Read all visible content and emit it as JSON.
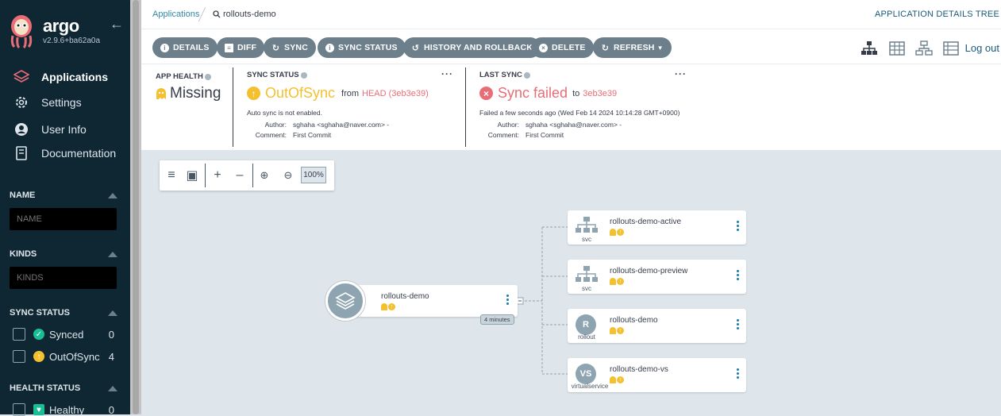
{
  "sidebar": {
    "brand": "argo",
    "version": "v2.9.6+ba62a0a",
    "nav": [
      {
        "label": "Applications",
        "icon": "layers-icon",
        "active": true
      },
      {
        "label": "Settings",
        "icon": "gear-icon",
        "active": false
      },
      {
        "label": "User Info",
        "icon": "user-icon",
        "active": false
      },
      {
        "label": "Documentation",
        "icon": "book-icon",
        "active": false
      }
    ],
    "filters": {
      "name": {
        "title": "NAME",
        "placeholder": "NAME"
      },
      "kinds": {
        "title": "KINDS",
        "placeholder": "KINDS"
      },
      "sync_status": {
        "title": "SYNC STATUS",
        "items": [
          {
            "label": "Synced",
            "count": "0",
            "color": "#18be94"
          },
          {
            "label": "OutOfSync",
            "count": "4",
            "color": "#f4c030"
          }
        ]
      },
      "health_status": {
        "title": "HEALTH STATUS",
        "items": [
          {
            "label": "Healthy",
            "count": "0",
            "color": "#18be94"
          }
        ]
      }
    }
  },
  "topbar": {
    "breadcrumb_root": "Applications",
    "breadcrumb_current": "rollouts-demo",
    "page_title": "APPLICATION DETAILS TREE"
  },
  "toolbar": {
    "buttons": [
      "DETAILS",
      "DIFF",
      "SYNC",
      "SYNC STATUS",
      "HISTORY AND ROLLBACK",
      "DELETE",
      "REFRESH"
    ],
    "logout": "Log out"
  },
  "status": {
    "app_health": {
      "title": "APP HEALTH",
      "value": "Missing"
    },
    "sync_status": {
      "title": "SYNC STATUS",
      "value": "OutOfSync",
      "from_label": "from",
      "from_ref": "HEAD (3eb3e39)",
      "note": "Auto sync is not enabled.",
      "author_label": "Author:",
      "author": "sghaha <sghaha@naver.com> -",
      "comment_label": "Comment:",
      "comment": "First Commit"
    },
    "last_sync": {
      "title": "LAST SYNC",
      "value": "Sync failed",
      "to_label": "to",
      "to_ref": "3eb3e39",
      "note": "Failed a few seconds ago (Wed Feb 14 2024 10:14:28 GMT+0900)",
      "author_label": "Author:",
      "author": "sghaha <sghaha@naver.com> -",
      "comment_label": "Comment:",
      "comment": "First Commit"
    }
  },
  "graph": {
    "zoom": "100%",
    "app": {
      "name": "rollouts-demo",
      "age": "4 minutes"
    },
    "resources": [
      {
        "name": "rollouts-demo-active",
        "kind": "svc"
      },
      {
        "name": "rollouts-demo-preview",
        "kind": "svc"
      },
      {
        "name": "rollouts-demo",
        "kind": "rollout",
        "icon_text": "R"
      },
      {
        "name": "rollouts-demo-vs",
        "kind": "virtualservice",
        "icon_text": "VS"
      }
    ]
  },
  "colors": {
    "sidebar_bg": "#0f2733",
    "accent": "#1a7aaa",
    "warning": "#f4c030",
    "error": "#e96d76",
    "button": "#6d7f8b"
  }
}
